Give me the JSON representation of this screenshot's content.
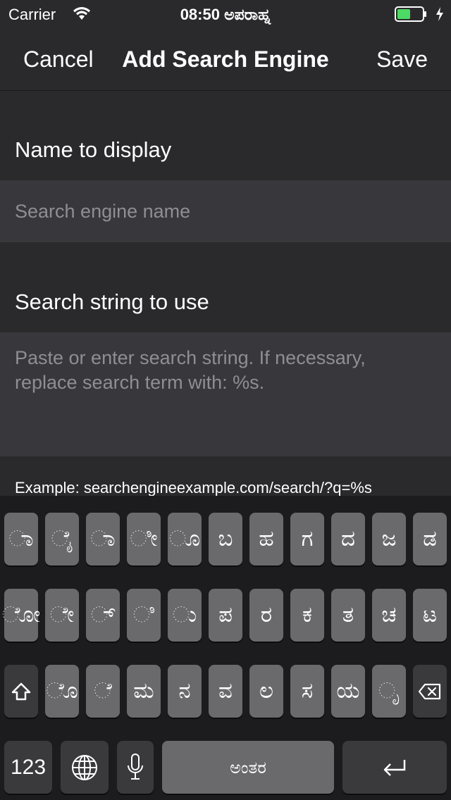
{
  "status_bar": {
    "carrier": "Carrier",
    "time": "08:50 ಅಪರಾಹ್ನ",
    "battery_color": "#4cd964"
  },
  "nav": {
    "cancel": "Cancel",
    "title": "Add Search Engine",
    "save": "Save"
  },
  "form": {
    "name_label": "Name to display",
    "name_placeholder": "Search engine name",
    "string_label": "Search string to use",
    "string_placeholder": "Paste or enter search string. If necessary, replace search term with: %s.",
    "example": "Example: searchengineexample.com/search/?q=%s"
  },
  "keyboard": {
    "row1": [
      "ಾ",
      "ೈ",
      "ಾ",
      "ೀ",
      "ೂ",
      "ಬ",
      "ಹ",
      "ಗ",
      "ದ",
      "ಜ",
      "ಡ"
    ],
    "row2": [
      "ೋ",
      "ೇ",
      "್",
      "ಿ",
      "ು",
      "ಪ",
      "ರ",
      "ಕ",
      "ತ",
      "ಚ",
      "ಟ"
    ],
    "row3": [
      "ೊ",
      "ೆ",
      "ಮ",
      "ನ",
      "ವ",
      "ಲ",
      "ಸ",
      "ಯ",
      "ೃ"
    ],
    "numbers_key": "123",
    "space_label": "ಅಂತರ",
    "icons": {
      "shift": "shift-icon",
      "delete": "delete-icon",
      "globe": "globe-icon",
      "mic": "microphone-icon",
      "return": "return-icon"
    }
  }
}
